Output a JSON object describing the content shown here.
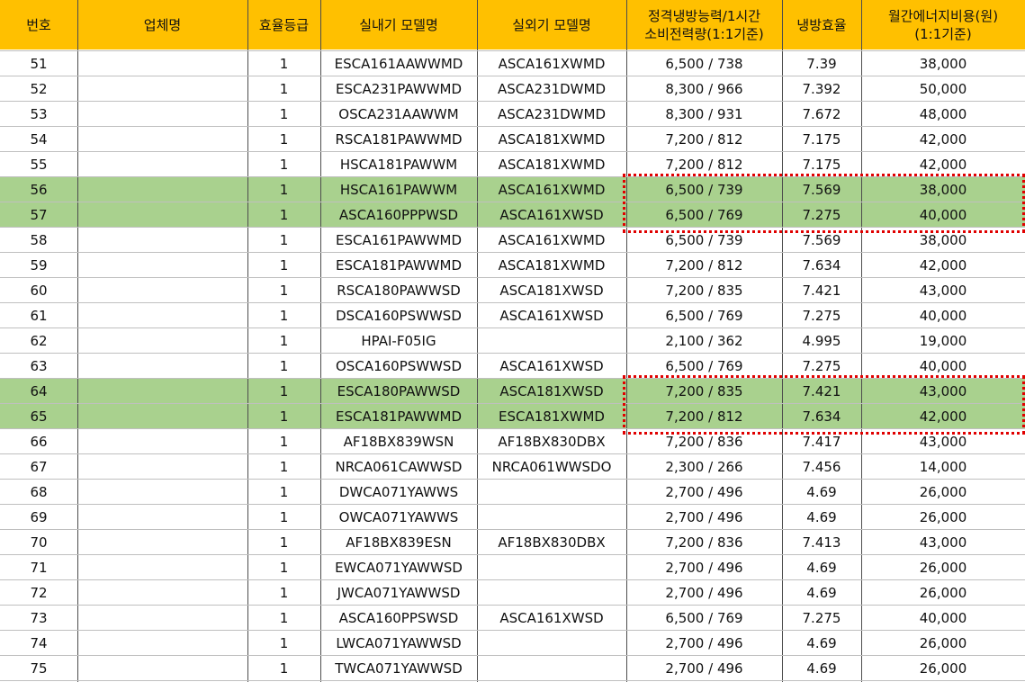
{
  "header": {
    "no": "번호",
    "company": "업체명",
    "grade": "효율등급",
    "indoor": "실내기 모델명",
    "outdoor": "실외기 모델명",
    "capacity_line1": "정격냉방능력/1시간",
    "capacity_line2": "소비전력량(1:1기준)",
    "efficiency": "냉방효율",
    "cost_line1": "월간에너지비용(원)",
    "cost_line2": "(1:1기준)"
  },
  "colors": {
    "header": "#ffc000",
    "highlight": "#a9d18e",
    "callout": "#e00000"
  },
  "rows": [
    {
      "no": "51",
      "company": "",
      "grade": "1",
      "indoor": "ESCA161AAWWMD",
      "outdoor": "ASCA161XWMD",
      "capacity": "6,500 / 738",
      "efficiency": "7.39",
      "cost": "38,000",
      "hl": false
    },
    {
      "no": "52",
      "company": "",
      "grade": "1",
      "indoor": "ESCA231PAWWMD",
      "outdoor": "ASCA231DWMD",
      "capacity": "8,300 / 966",
      "efficiency": "7.392",
      "cost": "50,000",
      "hl": false
    },
    {
      "no": "53",
      "company": "",
      "grade": "1",
      "indoor": "OSCA231AAWWM",
      "outdoor": "ASCA231DWMD",
      "capacity": "8,300 / 931",
      "efficiency": "7.672",
      "cost": "48,000",
      "hl": false
    },
    {
      "no": "54",
      "company": "",
      "grade": "1",
      "indoor": "RSCA181PAWWMD",
      "outdoor": "ASCA181XWMD",
      "capacity": "7,200 / 812",
      "efficiency": "7.175",
      "cost": "42,000",
      "hl": false
    },
    {
      "no": "55",
      "company": "",
      "grade": "1",
      "indoor": "HSCA181PAWWM",
      "outdoor": "ASCA181XWMD",
      "capacity": "7,200 / 812",
      "efficiency": "7.175",
      "cost": "42,000",
      "hl": false
    },
    {
      "no": "56",
      "company": "",
      "grade": "1",
      "indoor": "HSCA161PAWWM",
      "outdoor": "ASCA161XWMD",
      "capacity": "6,500 / 739",
      "efficiency": "7.569",
      "cost": "38,000",
      "hl": true
    },
    {
      "no": "57",
      "company": "",
      "grade": "1",
      "indoor": "ASCA160PPPWSD",
      "outdoor": "ASCA161XWSD",
      "capacity": "6,500 / 769",
      "efficiency": "7.275",
      "cost": "40,000",
      "hl": true
    },
    {
      "no": "58",
      "company": "",
      "grade": "1",
      "indoor": "ESCA161PAWWMD",
      "outdoor": "ASCA161XWMD",
      "capacity": "6,500 / 739",
      "efficiency": "7.569",
      "cost": "38,000",
      "hl": false
    },
    {
      "no": "59",
      "company": "",
      "grade": "1",
      "indoor": "ESCA181PAWWMD",
      "outdoor": "ASCA181XWMD",
      "capacity": "7,200 / 812",
      "efficiency": "7.634",
      "cost": "42,000",
      "hl": false
    },
    {
      "no": "60",
      "company": "",
      "grade": "1",
      "indoor": "RSCA180PAWWSD",
      "outdoor": "ASCA181XWSD",
      "capacity": "7,200 / 835",
      "efficiency": "7.421",
      "cost": "43,000",
      "hl": false
    },
    {
      "no": "61",
      "company": "",
      "grade": "1",
      "indoor": "DSCA160PSWWSD",
      "outdoor": "ASCA161XWSD",
      "capacity": "6,500 / 769",
      "efficiency": "7.275",
      "cost": "40,000",
      "hl": false
    },
    {
      "no": "62",
      "company": "",
      "grade": "1",
      "indoor": "HPAI-F05IG",
      "outdoor": "",
      "capacity": "2,100 / 362",
      "efficiency": "4.995",
      "cost": "19,000",
      "hl": false
    },
    {
      "no": "63",
      "company": "",
      "grade": "1",
      "indoor": "OSCA160PSWWSD",
      "outdoor": "ASCA161XWSD",
      "capacity": "6,500 / 769",
      "efficiency": "7.275",
      "cost": "40,000",
      "hl": false
    },
    {
      "no": "64",
      "company": "",
      "grade": "1",
      "indoor": "ESCA180PAWWSD",
      "outdoor": "ASCA181XWSD",
      "capacity": "7,200 / 835",
      "efficiency": "7.421",
      "cost": "43,000",
      "hl": true
    },
    {
      "no": "65",
      "company": "",
      "grade": "1",
      "indoor": "ESCA181PAWWMD",
      "outdoor": "ESCA181XWMD",
      "capacity": "7,200 / 812",
      "efficiency": "7.634",
      "cost": "42,000",
      "hl": true
    },
    {
      "no": "66",
      "company": "",
      "grade": "1",
      "indoor": "AF18BX839WSN",
      "outdoor": "AF18BX830DBX",
      "capacity": "7,200 / 836",
      "efficiency": "7.417",
      "cost": "43,000",
      "hl": false
    },
    {
      "no": "67",
      "company": "",
      "grade": "1",
      "indoor": "NRCA061CAWWSD",
      "outdoor": "NRCA061WWSDO",
      "capacity": "2,300 / 266",
      "efficiency": "7.456",
      "cost": "14,000",
      "hl": false
    },
    {
      "no": "68",
      "company": "",
      "grade": "1",
      "indoor": "DWCA071YAWWS",
      "outdoor": "",
      "capacity": "2,700 / 496",
      "efficiency": "4.69",
      "cost": "26,000",
      "hl": false
    },
    {
      "no": "69",
      "company": "",
      "grade": "1",
      "indoor": "OWCA071YAWWS",
      "outdoor": "",
      "capacity": "2,700 / 496",
      "efficiency": "4.69",
      "cost": "26,000",
      "hl": false
    },
    {
      "no": "70",
      "company": "",
      "grade": "1",
      "indoor": "AF18BX839ESN",
      "outdoor": "AF18BX830DBX",
      "capacity": "7,200 / 836",
      "efficiency": "7.413",
      "cost": "43,000",
      "hl": false
    },
    {
      "no": "71",
      "company": "",
      "grade": "1",
      "indoor": "EWCA071YAWWSD",
      "outdoor": "",
      "capacity": "2,700 / 496",
      "efficiency": "4.69",
      "cost": "26,000",
      "hl": false
    },
    {
      "no": "72",
      "company": "",
      "grade": "1",
      "indoor": "JWCA071YAWWSD",
      "outdoor": "",
      "capacity": "2,700 / 496",
      "efficiency": "4.69",
      "cost": "26,000",
      "hl": false
    },
    {
      "no": "73",
      "company": "",
      "grade": "1",
      "indoor": "ASCA160PPSWSD",
      "outdoor": "ASCA161XWSD",
      "capacity": "6,500 / 769",
      "efficiency": "7.275",
      "cost": "40,000",
      "hl": false
    },
    {
      "no": "74",
      "company": "",
      "grade": "1",
      "indoor": "LWCA071YAWWSD",
      "outdoor": "",
      "capacity": "2,700 / 496",
      "efficiency": "4.69",
      "cost": "26,000",
      "hl": false
    },
    {
      "no": "75",
      "company": "",
      "grade": "1",
      "indoor": "TWCA071YAWWSD",
      "outdoor": "",
      "capacity": "2,700 / 496",
      "efficiency": "4.69",
      "cost": "26,000",
      "hl": false
    }
  ]
}
